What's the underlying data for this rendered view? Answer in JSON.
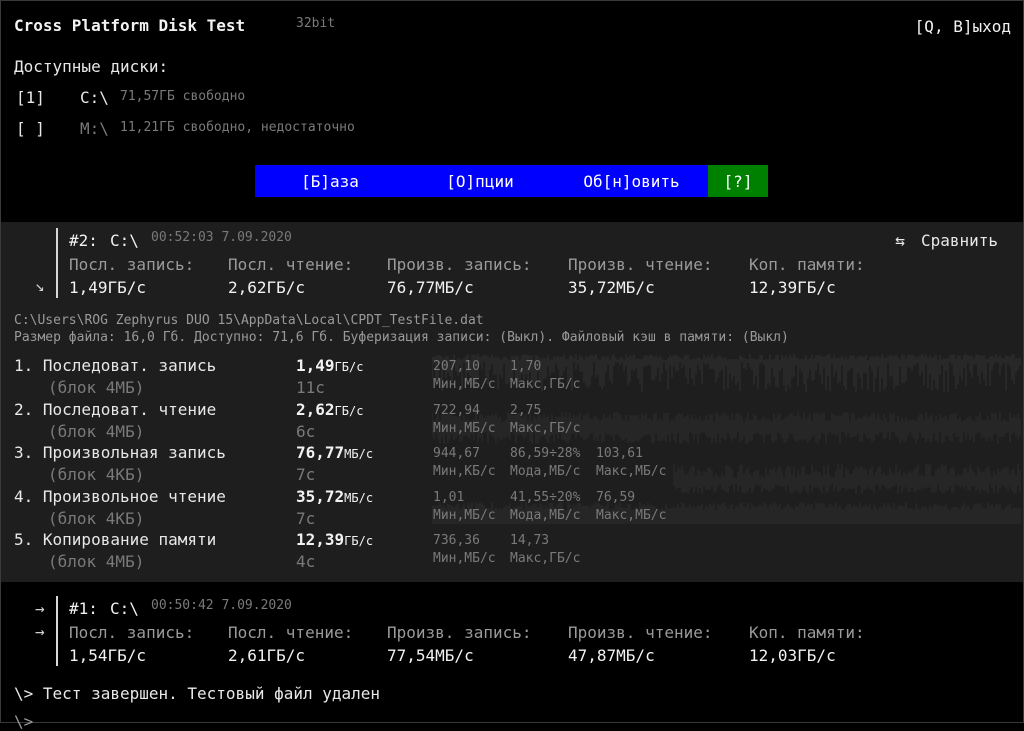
{
  "header": {
    "title": "Cross Platform Disk Test",
    "bits": "32bit",
    "exit": "[Q, В]ыход"
  },
  "disks": {
    "label": "Доступные диски:",
    "items": [
      {
        "check": "[1]",
        "letter": "C:\\",
        "info": "71,57ГБ свободно"
      },
      {
        "check": "[ ]",
        "letter": "M:\\",
        "info": "11,21ГБ свободно, недостаточно"
      }
    ]
  },
  "menu": {
    "base": "[Б]аза",
    "options": "[О]пции",
    "refresh": "Об[н]овить",
    "help": "[?]"
  },
  "colors": {
    "menu_bg": "#0000ff",
    "help_bg": "#008000",
    "panel_bg": "#1e1e1e"
  },
  "result2": {
    "id": "#2:",
    "drive": "C:\\",
    "time": "00:52:03 7.09.2020",
    "compare": "Сравнить",
    "compare_icon": "swap-arrows-icon",
    "collapse_arrow": "↘",
    "headers": [
      "Посл. запись:",
      "Посл. чтение:",
      "Произв. запись:",
      "Произв. чтение:",
      "Коп. памяти:"
    ],
    "values": [
      "1,49ГБ/с",
      "2,62ГБ/с",
      "76,77МБ/с",
      "35,72МБ/с",
      "12,39ГБ/с"
    ]
  },
  "file": {
    "path": "C:\\Users\\ROG Zephyrus DUO 15\\AppData\\Local\\CPDT_TestFile.dat",
    "info": "Размер файла: 16,0 Гб. Доступно: 71,6 Гб. Буферизация записи: (Выкл). Файловый кэш в памяти: (Выкл)"
  },
  "tests": [
    {
      "name": "1. Последоват. запись",
      "block": "(блок 4МБ)",
      "value": "1,49",
      "unit": "ГБ/с",
      "duration": "11с",
      "s1v": "207,10",
      "s1l": "Мин,МБ/с",
      "s2v": "1,70",
      "s2l": "Макс,ГБ/с",
      "s3v": "",
      "s3l": ""
    },
    {
      "name": "2. Последоват. чтение",
      "block": "(блок 4МБ)",
      "value": "2,62",
      "unit": "ГБ/с",
      "duration": "6с",
      "s1v": "722,94",
      "s1l": "Мин,МБ/с",
      "s2v": "2,75",
      "s2l": "Макс,ГБ/с",
      "s3v": "",
      "s3l": ""
    },
    {
      "name": "3. Произвольная запись",
      "block": "(блок 4КБ)",
      "value": "76,77",
      "unit": "МБ/с",
      "duration": "7с",
      "s1v": "944,67",
      "s1l": "Мин,КБ/с",
      "s2v": "86,59÷28%",
      "s2l": "Мода,МБ/с",
      "s3v": "103,61",
      "s3l": "Макс,МБ/с"
    },
    {
      "name": "4. Произвольное чтение",
      "block": "(блок 4КБ)",
      "value": "35,72",
      "unit": "МБ/с",
      "duration": "7с",
      "s1v": "1,01",
      "s1l": "Мин,МБ/с",
      "s2v": "41,55÷20%",
      "s2l": "Мода,МБ/с",
      "s3v": "76,59",
      "s3l": "Макс,МБ/с"
    },
    {
      "name": "5. Копирование памяти",
      "block": "(блок 4МБ)",
      "value": "12,39",
      "unit": "ГБ/с",
      "duration": "4с",
      "s1v": "736,36",
      "s1l": "Мин,МБ/с",
      "s2v": "14,73",
      "s2l": "Макс,ГБ/с",
      "s3v": "",
      "s3l": ""
    }
  ],
  "result1": {
    "id": "#1:",
    "drive": "C:\\",
    "time": "00:50:42 7.09.2020",
    "arrow": "→",
    "headers": [
      "Посл. запись:",
      "Посл. чтение:",
      "Произв. запись:",
      "Произв. чтение:",
      "Коп. памяти:"
    ],
    "values": [
      "1,54ГБ/с",
      "2,61ГБ/с",
      "77,54МБ/с",
      "47,87МБ/с",
      "12,03ГБ/с"
    ]
  },
  "console": {
    "status": "\\> Тест завершен. Тестовый файл удален",
    "prompt": "\\>"
  }
}
